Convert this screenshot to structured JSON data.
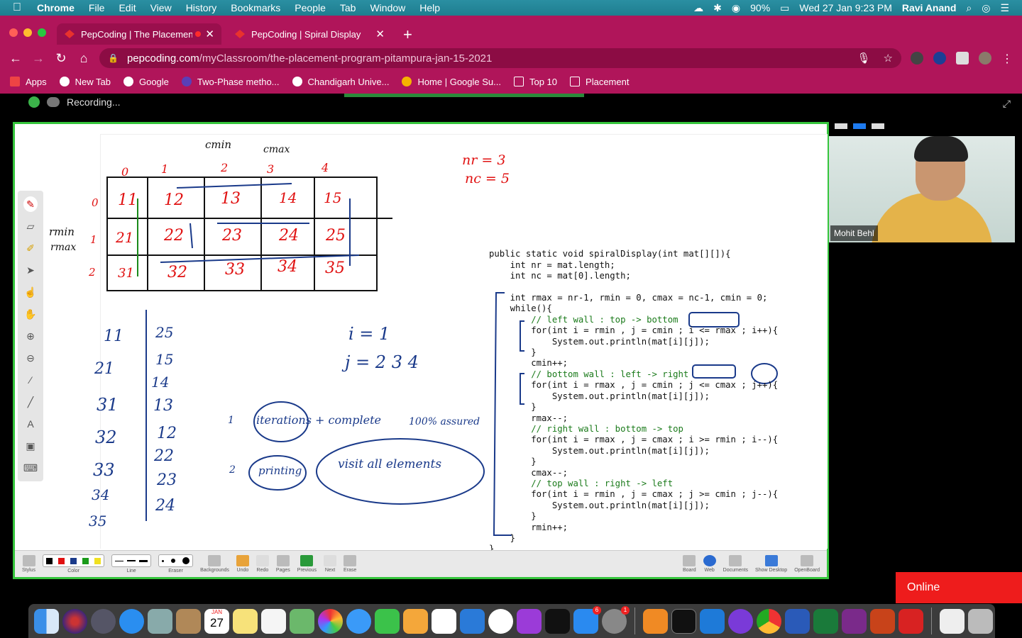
{
  "menubar": {
    "app": "Chrome",
    "menus": [
      "File",
      "Edit",
      "View",
      "History",
      "Bookmarks",
      "People",
      "Tab",
      "Window",
      "Help"
    ],
    "battery": "90%",
    "datetime": "Wed 27 Jan  9:23 PM",
    "user": "Ravi Anand"
  },
  "tabs": [
    {
      "title": "PepCoding | The Placemen",
      "close": "✕"
    },
    {
      "title": "PepCoding | Spiral Display",
      "close": "✕"
    }
  ],
  "new_tab": "+",
  "address": {
    "host": "pepcoding.com",
    "path": "/myClassroom/the-placement-program-pitampura-jan-15-2021"
  },
  "bookmarks": [
    {
      "label": "Apps"
    },
    {
      "label": "New Tab"
    },
    {
      "label": "Google"
    },
    {
      "label": "Two-Phase metho..."
    },
    {
      "label": "Chandigarh Unive..."
    },
    {
      "label": "Home | Google Su..."
    },
    {
      "label": "Top 10"
    },
    {
      "label": "Placement"
    }
  ],
  "recording": "Recording...",
  "code_lines": [
    "public static void spiralDisplay(int mat[][]){",
    "    int nr = mat.length;",
    "    int nc = mat[0].length;",
    "",
    "    int rmax = nr-1, rmin = 0, cmax = nc-1, cmin = 0;",
    "    while(){",
    "        // left wall : top -> bottom",
    "        for(int i = rmin , j = cmin ; i <= rmax ; i++){",
    "            System.out.println(mat[i][j]);",
    "        }",
    "        cmin++;",
    "        // bottom wall : left -> right",
    "        for(int i = rmax , j = cmin ; j <= cmax ; j++){",
    "            System.out.println(mat[i][j]);",
    "        }",
    "        rmax--;",
    "        // right wall : bottom -> top",
    "        for(int i = rmax , j = cmax ; i >= rmin ; i--){",
    "            System.out.println(mat[i][j]);",
    "        }",
    "        cmax--;",
    "        // top wall : right -> left",
    "        for(int i = rmin , j = cmax ; j >= cmin ; j--){",
    "            System.out.println(mat[i][j]);",
    "        }",
    "        rmin++;",
    "    }",
    "}"
  ],
  "whiteboard": {
    "col_indices": [
      "0",
      "1",
      "2",
      "3",
      "4"
    ],
    "row_indices": [
      "0",
      "1",
      "2"
    ],
    "matrix": [
      [
        "11",
        "12",
        "13",
        "14",
        "15"
      ],
      [
        "21",
        "22",
        "23",
        "24",
        "25"
      ],
      [
        "31",
        "32",
        "33",
        "34",
        "35"
      ]
    ],
    "labels": {
      "cmin": "cmin",
      "cmax": "cmax",
      "rmin": "rmin",
      "rmax": "rmax",
      "nr": "nr = 3",
      "nc": "nc = 5",
      "i": "i = 1",
      "j": "j = 2 3 4"
    },
    "list_left": [
      "11",
      "21",
      "31",
      "32",
      "33",
      "34",
      "35"
    ],
    "list_right": [
      "25",
      "15",
      "14",
      "13",
      "12",
      "22",
      "23",
      "24"
    ],
    "notes": [
      "iterations + complete",
      "100% assured",
      "printing",
      "visit all elements"
    ],
    "note_nums": [
      "1",
      "2"
    ]
  },
  "bottom_toolbar": {
    "labels": [
      "Stylus",
      "Color",
      "Line",
      "Eraser",
      "Backgrounds",
      "Undo",
      "Redo",
      "Pages",
      "Previous",
      "Next",
      "Erase",
      "Board",
      "Web",
      "Documents",
      "Show Desktop",
      "OpenBoard"
    ]
  },
  "video": {
    "name": "Mohit Behl"
  },
  "online_label": "Online",
  "dock": {
    "calendar_month": "JAN",
    "calendar_day": "27",
    "badges": [
      "6",
      "1"
    ]
  },
  "colors": {
    "chrome": "#b0155a",
    "board_border": "#35c53c",
    "ink_red": "#e01010",
    "ink_blue": "#1a3a8a",
    "online": "#ee1c1c"
  }
}
